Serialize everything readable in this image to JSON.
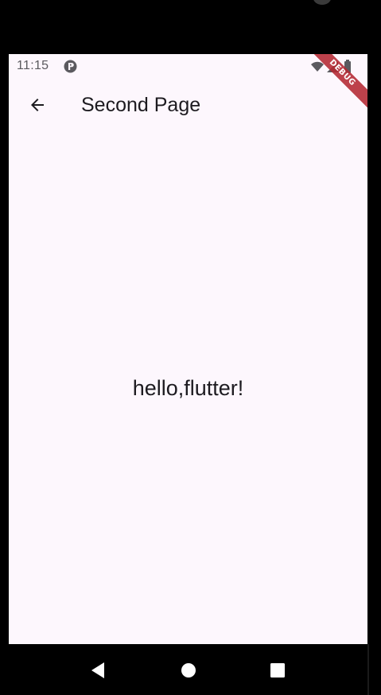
{
  "status_bar": {
    "time": "11:15",
    "app_icon": "app-notification-icon",
    "icons": [
      "wifi-icon",
      "signal-icon",
      "battery-icon"
    ]
  },
  "app_bar": {
    "back_icon": "arrow-back-icon",
    "title": "Second Page"
  },
  "body": {
    "text": "hello,flutter!"
  },
  "debug_banner": {
    "label": "DEBUG"
  },
  "nav_bar": {
    "icons": [
      "back-triangle-icon",
      "home-circle-icon",
      "recents-square-icon"
    ]
  },
  "colors": {
    "background": "#fdf7fd",
    "text": "#1d1b20",
    "status_text": "#5b5a5f",
    "debug_banner": "#b42832"
  }
}
